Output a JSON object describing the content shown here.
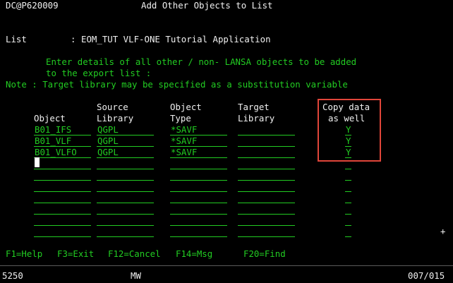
{
  "header": {
    "session": "DC@P620009",
    "title": "Add Other Objects to List"
  },
  "list_line": {
    "label": "List",
    "sep": ":",
    "value": "EOM_TUT VLF-ONE Tutorial Application"
  },
  "instructions": [
    "Enter details of all other / non- LANSA objects to be added",
    "to the export list :"
  ],
  "note": "Note : Target library may be specified as a substitution variable",
  "columns": {
    "object": {
      "l1": "",
      "l2": "Object"
    },
    "source": {
      "l1": "Source",
      "l2": "Library"
    },
    "type": {
      "l1": "Object",
      "l2": "Type"
    },
    "target": {
      "l1": "Target",
      "l2": "Library"
    },
    "copy": {
      "l1": "Copy data",
      "l2": "as well"
    }
  },
  "rows": [
    {
      "object": "B01_IFS",
      "source": "QGPL",
      "type": "*SAVF",
      "target": "",
      "copy": "Y"
    },
    {
      "object": "B01_VLF",
      "source": "QGPL",
      "type": "*SAVF",
      "target": "",
      "copy": "Y"
    },
    {
      "object": "B01_VLFO",
      "source": "QGPL",
      "type": "*SAVF",
      "target": "",
      "copy": "Y"
    },
    {
      "object": "",
      "source": "",
      "type": "",
      "target": "",
      "copy": ""
    },
    {
      "object": "",
      "source": "",
      "type": "",
      "target": "",
      "copy": ""
    },
    {
      "object": "",
      "source": "",
      "type": "",
      "target": "",
      "copy": ""
    },
    {
      "object": "",
      "source": "",
      "type": "",
      "target": "",
      "copy": ""
    },
    {
      "object": "",
      "source": "",
      "type": "",
      "target": "",
      "copy": ""
    },
    {
      "object": "",
      "source": "",
      "type": "",
      "target": "",
      "copy": ""
    },
    {
      "object": "",
      "source": "",
      "type": "",
      "target": "",
      "copy": ""
    }
  ],
  "more_indicator": "+",
  "fkeys": [
    "F1=Help",
    "F3=Exit",
    "F12=Cancel",
    "F14=Msg",
    "F20=Find"
  ],
  "statusbar": {
    "left": "5250",
    "mode": "MW",
    "pos": "007/015"
  },
  "colors": {
    "text": "#f0f0f0",
    "field": "#22cc22",
    "highlight": "#e0453a"
  }
}
